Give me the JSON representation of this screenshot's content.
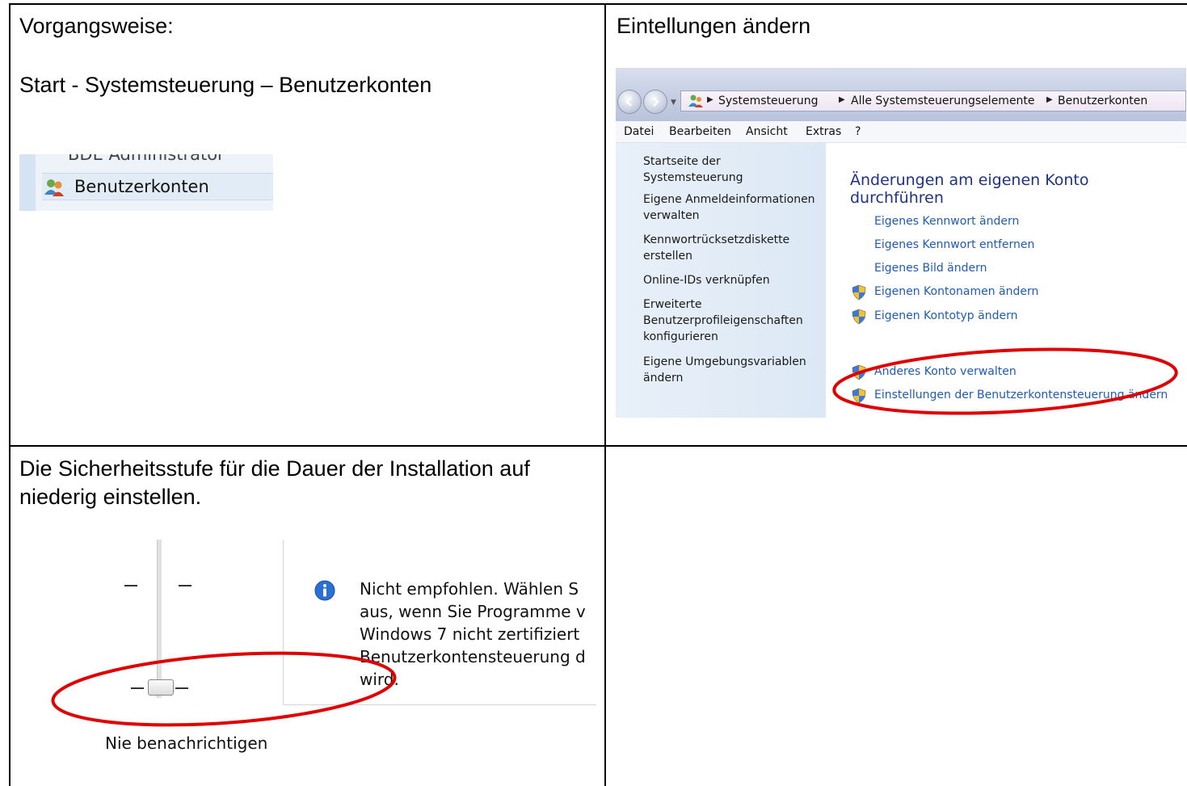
{
  "top_left": {
    "procedure_label": "Vorgangsweise:",
    "path_text": "Start - Systemsteuerung – Benutzerkonten",
    "snippet": {
      "cut_item": "BDE Administrator",
      "item_label": "Benutzerkonten"
    }
  },
  "top_right": {
    "heading": "Eintellungen ändern",
    "window": {
      "breadcrumb": [
        "Systemsteuerung",
        "Alle Systemsteuerungselemente",
        "Benutzerkonten"
      ],
      "menu": [
        "Datei",
        "Bearbeiten",
        "Ansicht",
        "Extras",
        "?"
      ],
      "left_links": [
        "Startseite der Systemsteuerung",
        "Eigene Anmeldeinformationen verwalten",
        "Kennwortrücksetzdiskette erstellen",
        "Online-IDs verknüpfen",
        "Erweiterte Benutzerprofileigenschaften konfigurieren",
        "Eigene Umgebungsvariablen ändern"
      ],
      "main_heading": "Änderungen am eigenen Konto durchführen",
      "tasks": [
        "Eigenes Kennwort ändern",
        "Eigenes Kennwort entfernen",
        "Eigenes Bild ändern",
        "Eigenen Kontonamen ändern",
        "Eigenen Kontotyp ändern",
        "Anderes Konto verwalten",
        "Einstellungen der Benutzerkontensteuerung ändern"
      ]
    },
    "highlight_color": "#e00000"
  },
  "bottom_left": {
    "instruction": "Die Sicherheitsstufe für die Dauer der Installation auf niederig einstellen.",
    "uac": {
      "info_lines": [
        "Nicht empfohlen. Wählen S",
        "aus, wenn Sie Programme v",
        "Windows 7 nicht zertifiziert",
        "Benutzerkontensteuerung d",
        "wird."
      ],
      "slider_label": "Nie benachrichtigen"
    }
  },
  "bottom_right": {}
}
